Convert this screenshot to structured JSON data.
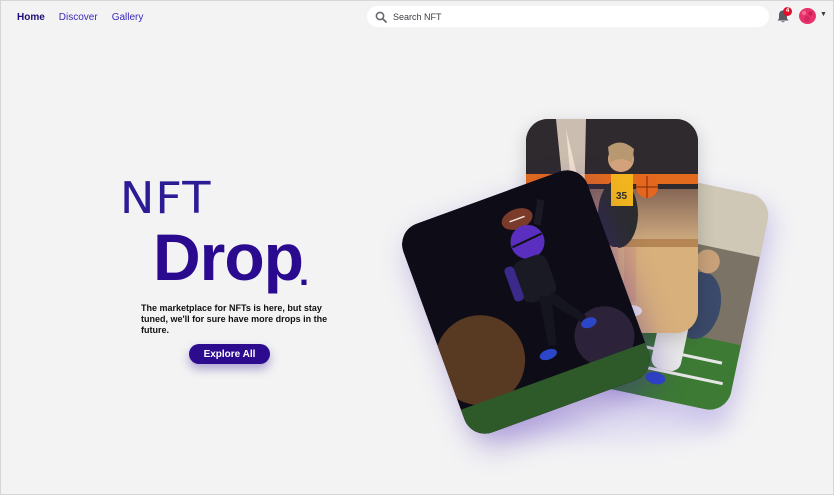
{
  "nav": {
    "links": [
      "Home",
      "Discover",
      "Gallery"
    ],
    "active": "Home",
    "search_placeholder": "Search NFT",
    "notification_count": "4"
  },
  "hero": {
    "title_small": "NFT",
    "title_large": "Drop",
    "title_dot": ".",
    "tagline": "The marketplace for NFTs is here,  but stay tuned, we'll for sure have more drops in the future.",
    "cta_label": "Explore All"
  },
  "cards": [
    {
      "subject": "football-player-catching-ball"
    },
    {
      "subject": "basketball-player-shooting"
    },
    {
      "subject": "football-player-in-stadium"
    }
  ],
  "colors": {
    "brand": "#2a0a8e",
    "nav_link": "#3a2ab8",
    "badge": "#e10f2a",
    "avatar": "#e8326b",
    "background": "#f3f3f4"
  }
}
